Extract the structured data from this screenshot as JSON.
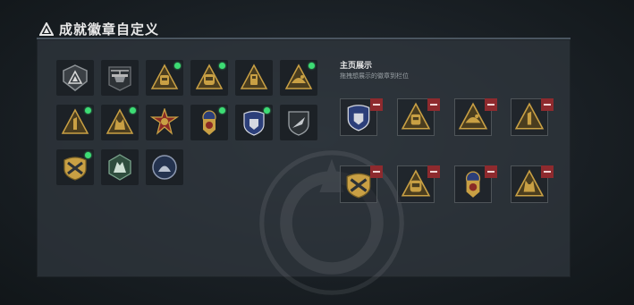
{
  "header": {
    "title": "成就徽章自定义"
  },
  "display_section": {
    "title": "主页展示",
    "subtitle": "拖拽想展示的徽章到栏位"
  },
  "badges": [
    {
      "name": "pyramid-gray-badge",
      "new": false,
      "style": "gray"
    },
    {
      "name": "helicopter-badge",
      "new": false,
      "style": "gray"
    },
    {
      "name": "backpack-gold-badge",
      "new": true,
      "style": "gold"
    },
    {
      "name": "helmet-gold-badge",
      "new": true,
      "style": "gold"
    },
    {
      "name": "device-gold-badge",
      "new": false,
      "style": "gold"
    },
    {
      "name": "bird-gold-badge",
      "new": true,
      "style": "gold"
    },
    {
      "name": "rank-one-badge",
      "new": true,
      "style": "gold"
    },
    {
      "name": "cat-gold-badge",
      "new": true,
      "style": "gold"
    },
    {
      "name": "cross-medal-badge",
      "new": false,
      "style": "medal"
    },
    {
      "name": "police-emblem-badge",
      "new": true,
      "style": "medal"
    },
    {
      "name": "police-shield-badge",
      "new": true,
      "style": "blue"
    },
    {
      "name": "falcon-shield-badge",
      "new": false,
      "style": "gray"
    },
    {
      "name": "sword-shield-badge",
      "new": true,
      "style": "medal"
    },
    {
      "name": "wolf-hex-badge",
      "new": false,
      "style": "green"
    },
    {
      "name": "bear-round-badge",
      "new": false,
      "style": "blue"
    }
  ],
  "display_slots": [
    {
      "name": "police-shield-badge",
      "style": "blue"
    },
    {
      "name": "backpack-gold-badge",
      "style": "gold"
    },
    {
      "name": "bird-gold-badge",
      "style": "gold"
    },
    {
      "name": "rank-one-badge",
      "style": "gold"
    },
    {
      "name": "sword-shield-badge",
      "style": "medal"
    },
    {
      "name": "helmet-gold-badge",
      "style": "gold"
    },
    {
      "name": "police-emblem-badge",
      "style": "medal"
    },
    {
      "name": "cat-gold-badge",
      "style": "gold"
    }
  ],
  "colors": {
    "accent_new": "#3ddc74",
    "remove": "#8e2a2e",
    "gold": "#c9a044"
  }
}
